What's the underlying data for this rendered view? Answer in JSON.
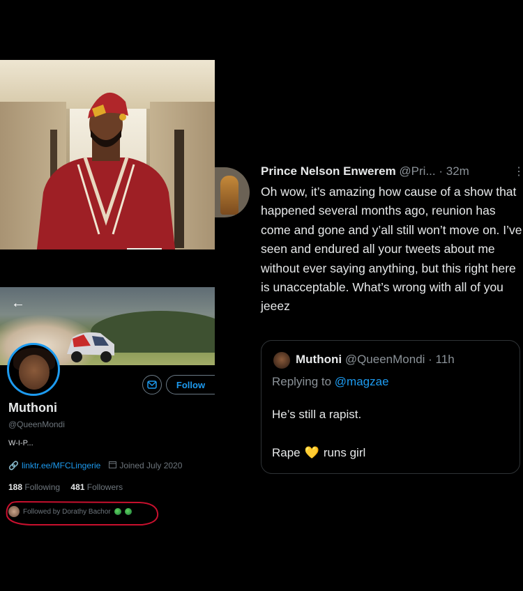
{
  "profile": {
    "back_icon": "arrow-left-icon",
    "message_icon": "envelope-icon",
    "follow_label": "Follow",
    "name": "Muthoni",
    "handle": "@QueenMondi",
    "bio": "W-I-P...",
    "link_icon": "link-icon",
    "link": "linktr.ee/MFCLingerie",
    "calendar_icon": "calendar-icon",
    "joined": "Joined July 2020",
    "following_count": "188",
    "following_label": "Following",
    "followers_count": "481",
    "followers_label": "Followers",
    "followed_by": "Followed by Dorathy Bachor"
  },
  "tweet": {
    "author": "Prince Nelson Enwerem",
    "handle": "@Pri...",
    "time": "· 32m",
    "more_icon": "more-vertical-icon",
    "body": "Oh wow, it’s amazing how cause of a show that happened several months ago, reunion has come and gone and y’all still won’t move on. I’ve seen and endured all your tweets about me without ever saying anything, but this right here is unacceptable. What’s wrong with all of you jeeez",
    "quote": {
      "author": "Muthoni",
      "handle": "@QueenMondi",
      "time": "· 11h",
      "replying_prefix": "Replying to",
      "replying_to": "@magzae",
      "line1": "He’s still a rapist.",
      "line2_a": "Rape",
      "line2_emoji": "💛",
      "line2_b": "runs girl"
    }
  },
  "colors": {
    "background": "#000000",
    "accent": "#1d9bf0",
    "muted": "#6e767d",
    "annotation": "#c8102e"
  }
}
